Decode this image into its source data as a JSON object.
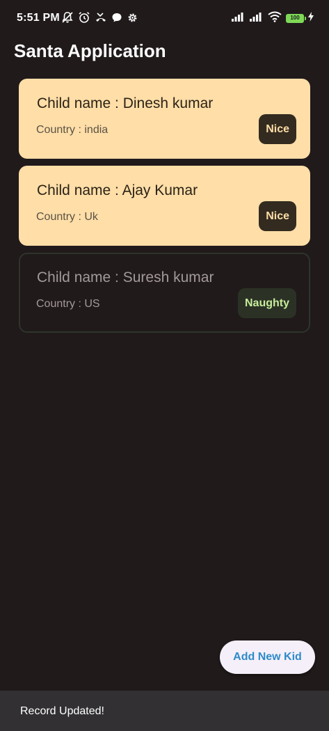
{
  "status_bar": {
    "time": "5:51 PM",
    "battery_level": "100",
    "left_icons": [
      "mute-icon",
      "alarm-icon",
      "missed-call-icon",
      "chat-bubble-icon",
      "settings-gear-icon"
    ],
    "right_icons": [
      "signal-icon",
      "signal-icon",
      "wifi-icon",
      "battery-icon",
      "charging-bolt-icon"
    ]
  },
  "app_bar": {
    "title": "Santa Application"
  },
  "kids": [
    {
      "name": "Child name : Dinesh kumar",
      "country": "Country : india",
      "status": "Nice"
    },
    {
      "name": "Child name : Ajay Kumar",
      "country": "Country : Uk",
      "status": "Nice"
    },
    {
      "name": "Child name : Suresh kumar",
      "country": "Country : US",
      "status": "Naughty"
    }
  ],
  "fab": {
    "label": "Add New Kid"
  },
  "snackbar": {
    "message": "Record Updated!"
  },
  "colors": {
    "background": "#201a1b",
    "nice_card": "#ffdea8",
    "nice_chip": "#332b1f",
    "naughty_chip": "#2b3225",
    "naughty_chip_text": "#c8ec9c",
    "fab_background": "#f5eff9",
    "fab_text": "#2d8bc9",
    "snackbar": "#323033"
  }
}
